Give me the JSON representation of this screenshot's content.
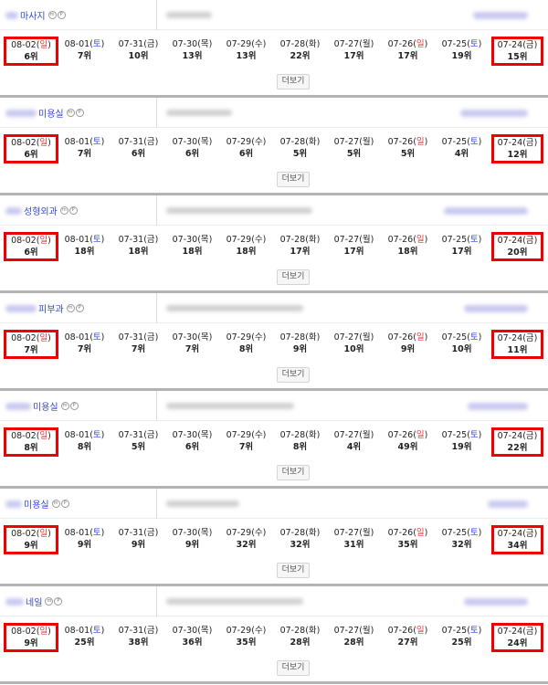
{
  "more_label": "더보기",
  "icon_letters": [
    "m",
    "P"
  ],
  "colors": {
    "highlight": "#ee0000",
    "sunday": "#e8363a",
    "saturday": "#2a3fd8",
    "keyword": "#3344dd"
  },
  "dates": [
    {
      "md": "08-02",
      "day": "일",
      "color": "red"
    },
    {
      "md": "08-01",
      "day": "토",
      "color": "blue"
    },
    {
      "md": "07-31",
      "day": "금",
      "color": ""
    },
    {
      "md": "07-30",
      "day": "목",
      "color": ""
    },
    {
      "md": "07-29",
      "day": "수",
      "color": ""
    },
    {
      "md": "07-28",
      "day": "화",
      "color": ""
    },
    {
      "md": "07-27",
      "day": "월",
      "color": ""
    },
    {
      "md": "07-26",
      "day": "일",
      "color": "red"
    },
    {
      "md": "07-25",
      "day": "토",
      "color": "blue"
    },
    {
      "md": "07-24",
      "day": "금",
      "color": ""
    }
  ],
  "cards": [
    {
      "keyword": "마사지",
      "ranks": [
        "6위",
        "7위",
        "10위",
        "13위",
        "13위",
        "22위",
        "17위",
        "17위",
        "19위",
        "15위"
      ]
    },
    {
      "keyword": "미용실",
      "ranks": [
        "6위",
        "7위",
        "6위",
        "6위",
        "6위",
        "5위",
        "5위",
        "5위",
        "4위",
        "12위"
      ]
    },
    {
      "keyword": "성형외과",
      "ranks": [
        "6위",
        "18위",
        "18위",
        "18위",
        "18위",
        "17위",
        "17위",
        "18위",
        "17위",
        "20위"
      ]
    },
    {
      "keyword": "피부과",
      "ranks": [
        "7위",
        "7위",
        "7위",
        "7위",
        "8위",
        "9위",
        "10위",
        "9위",
        "10위",
        "11위"
      ]
    },
    {
      "keyword": "미용실",
      "ranks": [
        "8위",
        "8위",
        "5위",
        "6위",
        "7위",
        "8위",
        "4위",
        "49위",
        "19위",
        "22위"
      ]
    },
    {
      "keyword": "미용실",
      "ranks": [
        "9위",
        "9위",
        "9위",
        "9위",
        "32위",
        "32위",
        "31위",
        "35위",
        "32위",
        "34위"
      ]
    },
    {
      "keyword": "네일",
      "ranks": [
        "9위",
        "25위",
        "38위",
        "36위",
        "35위",
        "28위",
        "28위",
        "27위",
        "25위",
        "24위"
      ]
    }
  ]
}
